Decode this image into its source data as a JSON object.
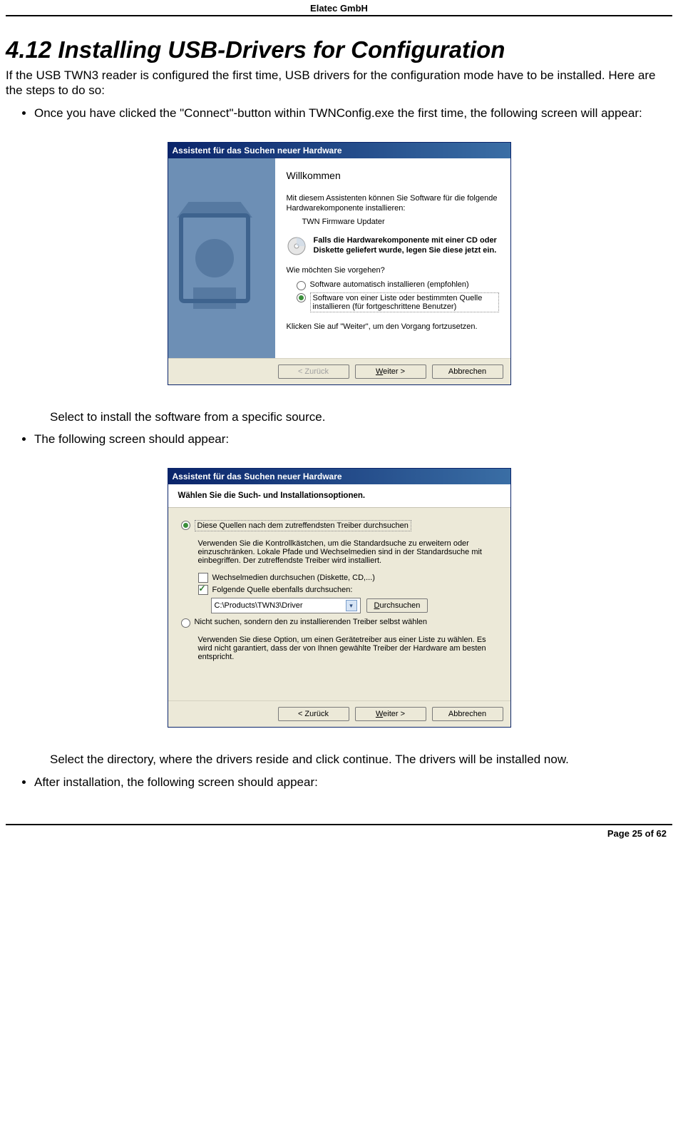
{
  "header": {
    "company": "Elatec GmbH"
  },
  "section": {
    "title": "4.12 Installing USB-Drivers for Configuration"
  },
  "intro": "If the USB TWN3 reader is configured the first time, USB drivers for the configuration mode have to be installed. Here are the steps to do so:",
  "bullets": {
    "b1": "Once you have clicked the \"Connect\"-button within TWNConfig.exe the first time, the following screen will appear:",
    "after1": "Select to install the software from a specific source.",
    "b2": "The following screen should appear:",
    "after2": "Select the directory, where the drivers reside and click continue. The drivers will be installed now.",
    "b3": "After installation, the following screen should appear:"
  },
  "wizard1": {
    "title": "Assistent für das Suchen neuer Hardware",
    "welcome": "Willkommen",
    "p1": "Mit diesem Assistenten können Sie Software für die folgende Hardwarekomponente installieren:",
    "device": "TWN Firmware Updater",
    "cd": "Falls die Hardwarekomponente mit einer CD oder Diskette geliefert wurde, legen Sie diese jetzt ein.",
    "q": "Wie möchten Sie vorgehen?",
    "opt1": "Software automatisch installieren (empfohlen)",
    "opt2": "Software von einer Liste oder bestimmten Quelle installieren (für fortgeschrittene Benutzer)",
    "cont": "Klicken Sie auf \"Weiter\", um den Vorgang fortzusetzen.",
    "btn_back": "< Zurück",
    "btn_next": "Weiter >",
    "btn_cancel": "Abbrechen"
  },
  "wizard2": {
    "title": "Assistent für das Suchen neuer Hardware",
    "banner": "Wählen Sie die Such- und Installationsoptionen.",
    "opt_search": "Diese Quellen nach dem zutreffendsten Treiber durchsuchen",
    "search_desc": "Verwenden Sie die Kontrollkästchen, um die Standardsuche zu erweitern oder einzuschränken. Lokale Pfade und Wechselmedien sind in der Standardsuche mit einbegriffen. Der zutreffendste Treiber wird installiert.",
    "chk1": "Wechselmedien durchsuchen (Diskette, CD,...)",
    "chk2": "Folgende Quelle ebenfalls durchsuchen:",
    "path": "C:\\Products\\TWN3\\Driver",
    "browse": "Durchsuchen",
    "opt_noSearch": "Nicht suchen, sondern den zu installierenden Treiber selbst wählen",
    "noSearch_desc": "Verwenden Sie diese Option, um einen Gerätetreiber aus einer Liste zu wählen. Es wird nicht garantiert, dass der von Ihnen gewählte Treiber der Hardware am besten entspricht.",
    "btn_back": "< Zurück",
    "btn_next": "Weiter >",
    "btn_cancel": "Abbrechen"
  },
  "footer": {
    "page": "Page 25 of 62"
  }
}
